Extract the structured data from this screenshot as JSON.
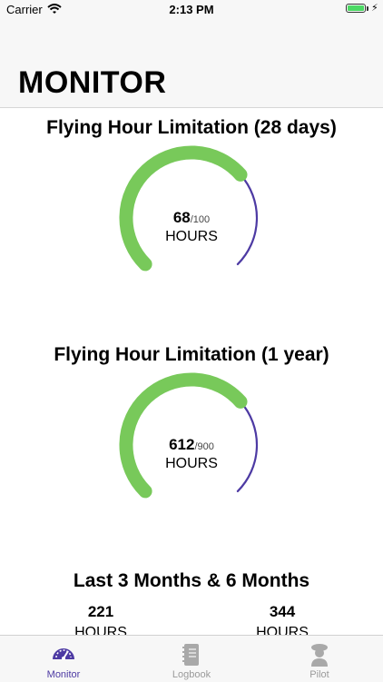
{
  "status_bar": {
    "carrier": "Carrier",
    "time": "2:13 PM"
  },
  "header": {
    "title": "MONITOR"
  },
  "gauges": [
    {
      "title": "Flying Hour Limitation (28 days)",
      "value": "68",
      "max": "/100",
      "unit": "HOURS",
      "fraction": 0.68
    },
    {
      "title": "Flying Hour Limitation (1 year)",
      "value": "612",
      "max": "/900",
      "unit": "HOURS",
      "fraction": 0.68
    }
  ],
  "summary": {
    "title": "Last 3 Months & 6 Months",
    "three_months": {
      "value": "221",
      "unit": "HOURS"
    },
    "six_months": {
      "value": "344",
      "unit": "HOURS"
    }
  },
  "tabs": [
    {
      "label": "Monitor",
      "icon": "gauge-icon",
      "active": true
    },
    {
      "label": "Logbook",
      "icon": "logbook-icon",
      "active": false
    },
    {
      "label": "Pilot",
      "icon": "pilot-icon",
      "active": false
    }
  ],
  "colors": {
    "progress": "#78c95a",
    "track": "#4d3aa3",
    "active_tab": "#4d3aa3",
    "inactive_tab": "#9a9a9a"
  }
}
